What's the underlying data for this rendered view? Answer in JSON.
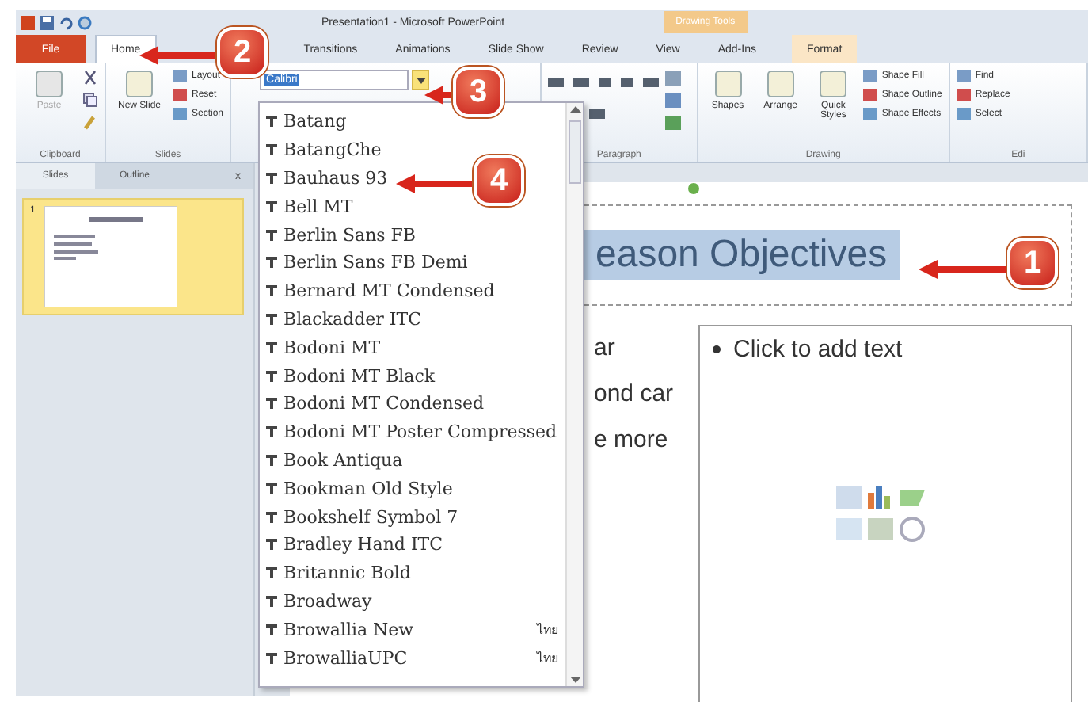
{
  "window": {
    "title": "Presentation1 - Microsoft PowerPoint",
    "contextual_tab": "Drawing Tools"
  },
  "tabs": [
    {
      "label": "File",
      "kind": "file",
      "selected": false
    },
    {
      "label": "Home",
      "kind": "tab",
      "selected": true
    },
    {
      "label": "Transitions",
      "kind": "tab",
      "selected": false
    },
    {
      "label": "Animations",
      "kind": "tab",
      "selected": false
    },
    {
      "label": "Slide Show",
      "kind": "tab",
      "selected": false
    },
    {
      "label": "Review",
      "kind": "tab",
      "selected": false
    },
    {
      "label": "View",
      "kind": "tab",
      "selected": false
    },
    {
      "label": "Add-Ins",
      "kind": "tab",
      "selected": false
    },
    {
      "label": "Format",
      "kind": "contextual",
      "selected": false
    }
  ],
  "ribbon": {
    "groups": [
      {
        "kind": "clipboard",
        "label": "Clipboard",
        "large": [
          {
            "label": "Paste",
            "disabled": true
          }
        ]
      },
      {
        "kind": "slides",
        "label": "Slides",
        "large": [
          {
            "label": "New Slide",
            "disabled": false
          }
        ],
        "small": [
          "Layout",
          "Reset",
          "Section"
        ]
      },
      {
        "kind": "font",
        "font_name": "Calibri"
      },
      {
        "kind": "paragraph",
        "label": "Paragraph"
      },
      {
        "kind": "drawing",
        "label": "Drawing",
        "large": [
          {
            "label": "Shapes",
            "disabled": false
          },
          {
            "label": "Arrange",
            "disabled": false
          },
          {
            "label": "Quick Styles",
            "disabled": false
          }
        ],
        "small": [
          "Shape Fill",
          "Shape Outline",
          "Shape Effects"
        ]
      },
      {
        "kind": "editing",
        "label": "Edi",
        "small": [
          "Find",
          "Replace",
          "Select"
        ]
      }
    ]
  },
  "font_list": {
    "items": [
      {
        "name": "Batang"
      },
      {
        "name": "BatangChe"
      },
      {
        "name": "Bauhaus 93"
      },
      {
        "name": "Bell MT"
      },
      {
        "name": "Berlin Sans FB"
      },
      {
        "name": "Berlin Sans FB Demi"
      },
      {
        "name": "Bernard MT Condensed"
      },
      {
        "name": "Blackadder ITC"
      },
      {
        "name": "Bodoni MT"
      },
      {
        "name": "Bodoni MT Black"
      },
      {
        "name": "Bodoni MT Condensed"
      },
      {
        "name": "Bodoni MT Poster Compressed"
      },
      {
        "name": "Book Antiqua"
      },
      {
        "name": "Bookman Old Style"
      },
      {
        "name": "Bookshelf Symbol 7"
      },
      {
        "name": "Bradley Hand ITC"
      },
      {
        "name": "Britannic Bold"
      },
      {
        "name": "Broadway"
      },
      {
        "name": "Browallia New",
        "sample": "ไทย"
      },
      {
        "name": "BrowalliaUPC",
        "sample": "ไทย"
      }
    ]
  },
  "slides_pane": {
    "tabs": [
      {
        "label": "Slides",
        "selected": true
      },
      {
        "label": "Outline",
        "selected": false
      }
    ],
    "close": "x",
    "thumbnails": [
      {
        "number": "1",
        "selected": true
      }
    ]
  },
  "slide": {
    "title": "eason Objectives",
    "title_selected": true,
    "body_lines": [
      "ar",
      "ond car",
      "e more"
    ],
    "placeholder": "Click to add text"
  },
  "callouts": [
    {
      "number": "1"
    },
    {
      "number": "2"
    },
    {
      "number": "3"
    },
    {
      "number": "4"
    }
  ]
}
